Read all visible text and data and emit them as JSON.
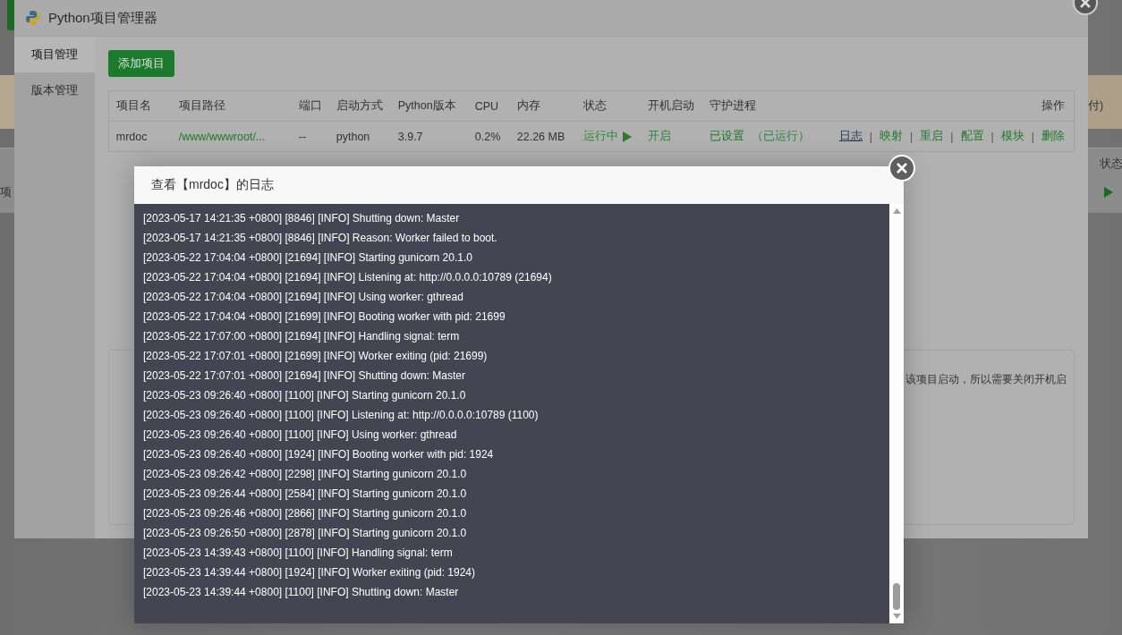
{
  "background": {
    "texts": [
      {
        "kind": "right",
        "text": "付)"
      },
      {
        "kind": "header",
        "text": "状态"
      },
      {
        "kind": "left",
        "text": "项"
      }
    ]
  },
  "window": {
    "title": "Python项目管理器"
  },
  "sidebar": {
    "items": [
      {
        "label": "项目管理",
        "selected": true
      },
      {
        "label": "版本管理",
        "selected": false
      }
    ]
  },
  "add_button": "添加项目",
  "table": {
    "columns": [
      "项目名",
      "项目路径",
      "端口",
      "启动方式",
      "Python版本",
      "CPU",
      "内存",
      "状态",
      "开机启动",
      "守护进程",
      "操作"
    ],
    "rows": [
      {
        "name": "mrdoc",
        "path": "/www/wwwroot/...",
        "port": "--",
        "start_mode": "python",
        "python_version": "3.9.7",
        "cpu": "0.2%",
        "memory": "22.26 MB",
        "status": "运行中",
        "running": true,
        "autostart": "开启",
        "daemon": "已设置",
        "daemon_state": "（已运行）",
        "separator": "|",
        "actions": [
          {
            "label": "日志",
            "selected": true
          },
          {
            "label": "映射",
            "selected": false
          },
          {
            "label": "重启",
            "selected": false
          },
          {
            "label": "配置",
            "selected": false
          },
          {
            "label": "模块",
            "selected": false
          },
          {
            "label": "删除",
            "selected": false
          }
        ]
      }
    ]
  },
  "notice": "该项目启动，所以需要关闭开机启",
  "log_dialog": {
    "title": "查看【mrdoc】的日志",
    "lines": [
      "[2023-05-17 14:21:35 +0800] [8846] [INFO] Shutting down: Master",
      "[2023-05-17 14:21:35 +0800] [8846] [INFO] Reason: Worker failed to boot.",
      "[2023-05-22 17:04:04 +0800] [21694] [INFO] Starting gunicorn 20.1.0",
      "[2023-05-22 17:04:04 +0800] [21694] [INFO] Listening at: http://0.0.0.0:10789 (21694)",
      "[2023-05-22 17:04:04 +0800] [21694] [INFO] Using worker: gthread",
      "[2023-05-22 17:04:04 +0800] [21699] [INFO] Booting worker with pid: 21699",
      "[2023-05-22 17:07:00 +0800] [21694] [INFO] Handling signal: term",
      "[2023-05-22 17:07:01 +0800] [21699] [INFO] Worker exiting (pid: 21699)",
      "[2023-05-22 17:07:01 +0800] [21694] [INFO] Shutting down: Master",
      "[2023-05-23 09:26:40 +0800] [1100] [INFO] Starting gunicorn 20.1.0",
      "[2023-05-23 09:26:40 +0800] [1100] [INFO] Listening at: http://0.0.0.0:10789 (1100)",
      "[2023-05-23 09:26:40 +0800] [1100] [INFO] Using worker: gthread",
      "[2023-05-23 09:26:40 +0800] [1924] [INFO] Booting worker with pid: 1924",
      "[2023-05-23 09:26:42 +0800] [2298] [INFO] Starting gunicorn 20.1.0",
      "[2023-05-23 09:26:44 +0800] [2584] [INFO] Starting gunicorn 20.1.0",
      "[2023-05-23 09:26:46 +0800] [2866] [INFO] Starting gunicorn 20.1.0",
      "[2023-05-23 09:26:50 +0800] [2878] [INFO] Starting gunicorn 20.1.0",
      "[2023-05-23 14:39:43 +0800] [1100] [INFO] Handling signal: term",
      "[2023-05-23 14:39:44 +0800] [1924] [INFO] Worker exiting (pid: 1924)",
      "[2023-05-23 14:39:44 +0800] [1100] [INFO] Shutting down: Master"
    ]
  }
}
